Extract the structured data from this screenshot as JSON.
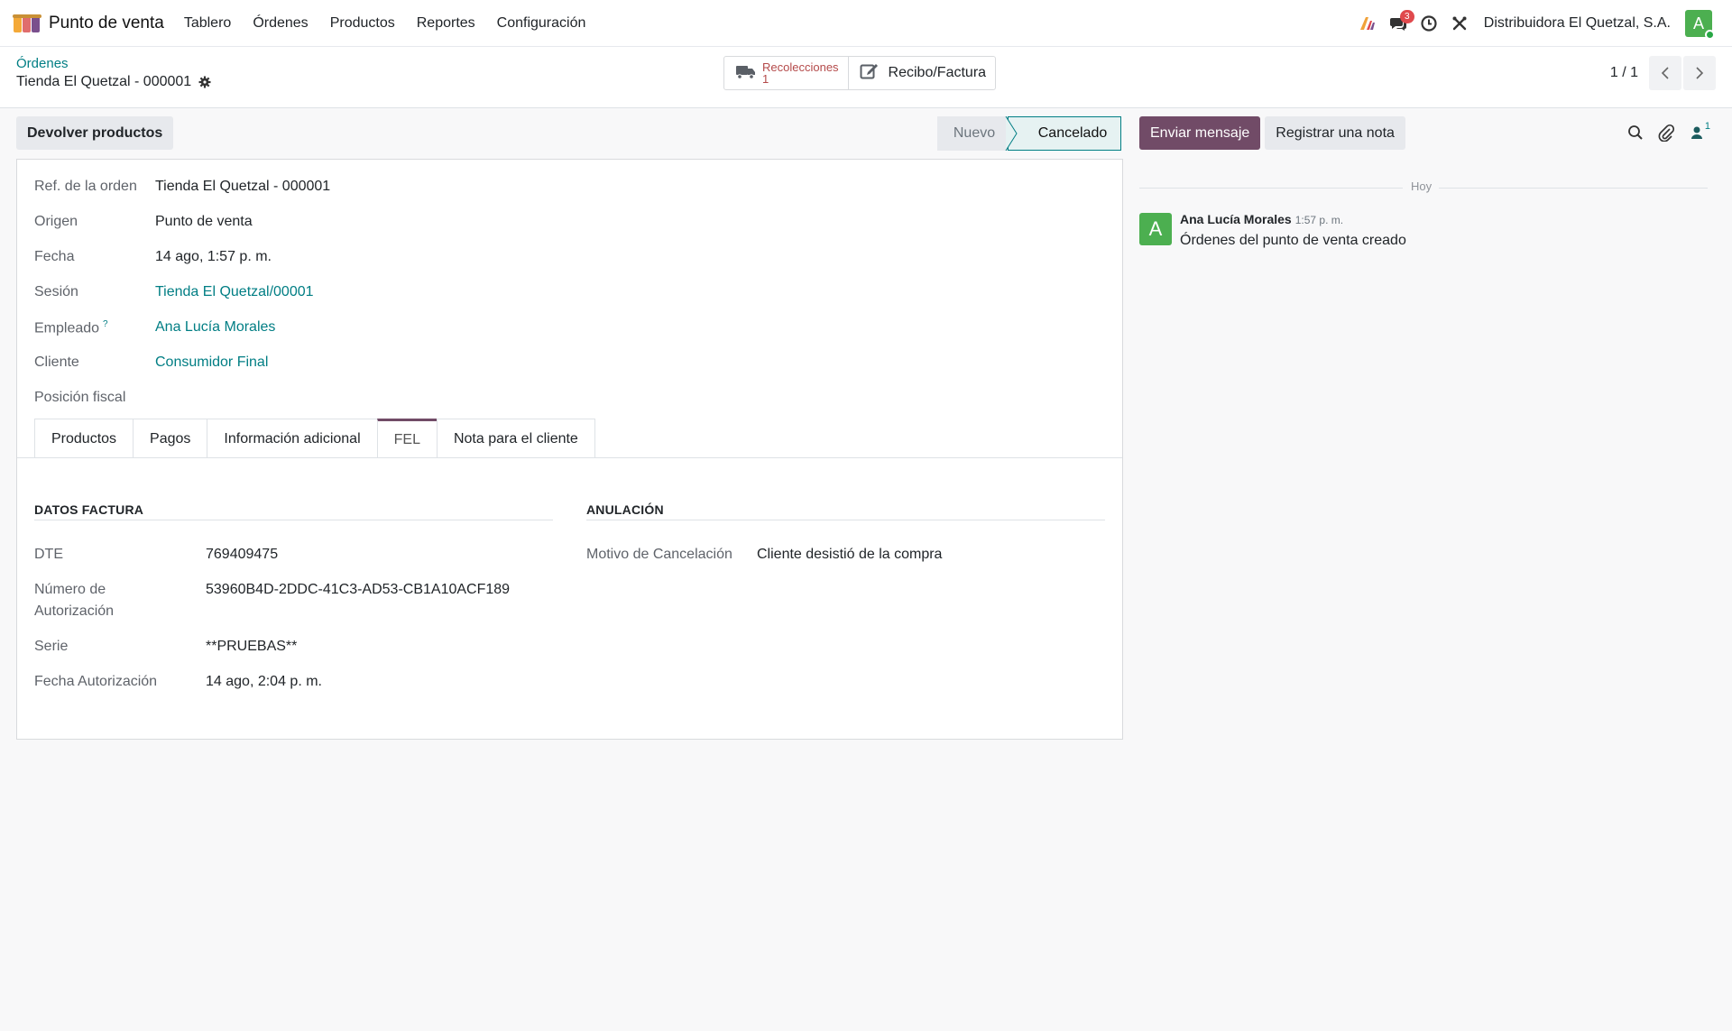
{
  "navbar": {
    "app_name": "Punto de venta",
    "menu": [
      "Tablero",
      "Órdenes",
      "Productos",
      "Reportes",
      "Configuración"
    ],
    "messages_badge": "3",
    "company": "Distribuidora El Quetzal, S.A.",
    "user_initial": "A"
  },
  "control_panel": {
    "breadcrumb_parent": "Órdenes",
    "breadcrumb_current": "Tienda El Quetzal - 000001",
    "smart_pickings_label": "Recolecciones",
    "smart_pickings_count": "1",
    "smart_invoice_label": "Recibo/Factura",
    "pager_value": "1 / 1"
  },
  "actions": {
    "return_button": "Devolver productos"
  },
  "statusbar": {
    "stages": [
      "Nuevo",
      "Cancelado"
    ],
    "current": "Cancelado"
  },
  "form": {
    "fields": [
      {
        "label": "Ref. de la orden",
        "value": "Tienda El Quetzal - 000001"
      },
      {
        "label": "Origen",
        "value": "Punto de venta"
      },
      {
        "label": "Fecha",
        "value": "14 ago, 1:57 p. m."
      },
      {
        "label": "Sesión",
        "value": "Tienda El Quetzal/00001"
      },
      {
        "label": "Empleado",
        "value": "Ana Lucía Morales",
        "help": "?"
      },
      {
        "label": "Cliente",
        "value": "Consumidor Final"
      },
      {
        "label": "Posición fiscal",
        "value": ""
      }
    ],
    "tabs": [
      "Productos",
      "Pagos",
      "Información adicional",
      "FEL",
      "Nota para el cliente"
    ],
    "active_tab": "FEL"
  },
  "fel": {
    "datos_title": "DATOS FACTURA",
    "anulacion_title": "ANULACIÓN",
    "datos": [
      {
        "label": "DTE",
        "value": "769409475"
      },
      {
        "label": "Número de Autorización",
        "label_line1": "Número de",
        "label_line2": "Autorización",
        "value": "53960B4D-2DDC-41C3-AD53-CB1A10ACF189"
      },
      {
        "label": "Serie",
        "value": "**PRUEBAS**"
      },
      {
        "label": "Fecha Autorización",
        "value": "14 ago, 2:04 p. m."
      }
    ],
    "anulacion": [
      {
        "label": "Motivo de Cancelación",
        "value": "Cliente desistió de la compra"
      }
    ]
  },
  "chatter": {
    "send_button": "Enviar mensaje",
    "note_button": "Registrar una nota",
    "followers_count": "1",
    "date_separator": "Hoy",
    "message": {
      "author_initial": "A",
      "author": "Ana Lucía Morales",
      "time": "1:57 p. m.",
      "body": "Órdenes del punto de venta creado"
    }
  },
  "colors": {
    "primary": "#714b67",
    "link": "#017e84",
    "avatar": "#4caf50",
    "badge": "#e0494d"
  }
}
